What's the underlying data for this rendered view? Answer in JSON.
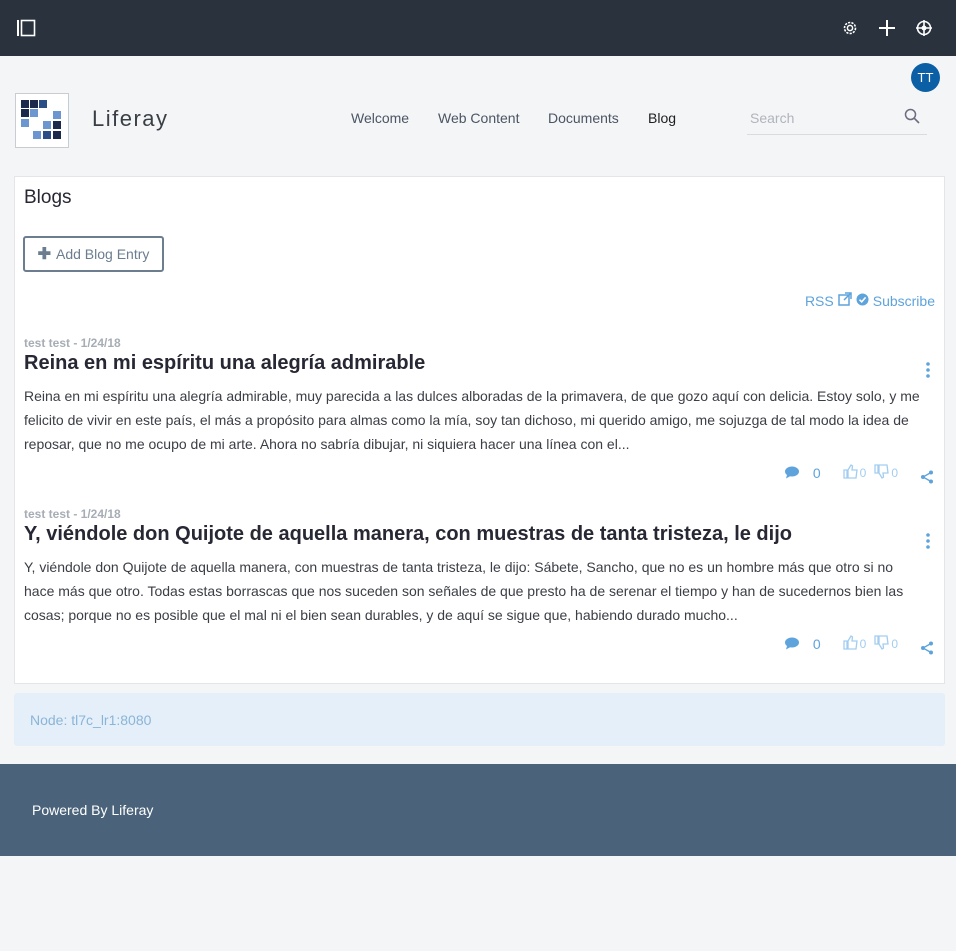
{
  "topbar": {
    "sidebar_toggle_icon": "sidebar-toggle-icon",
    "settings_icon": "gear-icon",
    "add_icon": "plus-icon",
    "simulation_icon": "simulation-icon"
  },
  "user": {
    "initials": "TT"
  },
  "site": {
    "name": "Liferay"
  },
  "nav": {
    "items": [
      {
        "label": "Welcome"
      },
      {
        "label": "Web Content"
      },
      {
        "label": "Documents"
      },
      {
        "label": "Blog"
      }
    ],
    "active": "Blog"
  },
  "search": {
    "placeholder": "Search",
    "icon": "search-icon"
  },
  "blogs": {
    "title": "Blogs",
    "add_button_label": "Add Blog Entry",
    "rss_label": "RSS",
    "subscribe_label": "Subscribe",
    "entries": [
      {
        "meta": "test test - 1/24/18",
        "title": "Reina en mi espíritu una alegría admirable",
        "body": "Reina en mi espíritu una alegría admirable, muy parecida a las dulces alboradas de la primavera, de que gozo aquí con delicia. Estoy solo, y me felicito de vivir en este país, el más a propósito para almas como la mía, soy tan dichoso, mi querido amigo, me sojuzga de tal modo la idea de reposar, que no me ocupo de mi arte. Ahora no sabría dibujar, ni siquiera hacer una línea con el...",
        "comments": "0",
        "thumbs_up": "0",
        "thumbs_down": "0"
      },
      {
        "meta": "test test - 1/24/18",
        "title": "Y, viéndole don Quijote de aquella manera, con muestras de tanta tristeza, le dijo",
        "body": "Y, viéndole don Quijote de aquella manera, con muestras de tanta tristeza, le dijo: Sábete, Sancho, que no es un hombre más que otro si no hace más que otro. Todas estas borrascas que nos suceden son señales de que presto ha de serenar el tiempo y han de sucedernos bien las cosas; porque no es posible que el mal ni el bien sean durables, y de aquí se sigue que, habiendo durado mucho...",
        "comments": "0",
        "thumbs_up": "0",
        "thumbs_down": "0"
      }
    ]
  },
  "node": {
    "text": "Node: tl7c_lr1:8080"
  },
  "footer": {
    "text": "Powered By Liferay"
  },
  "colors": {
    "topbar": "#29323d",
    "accent": "#5ea3dc",
    "footer": "#4a637a",
    "avatar": "#0b5fa5"
  }
}
